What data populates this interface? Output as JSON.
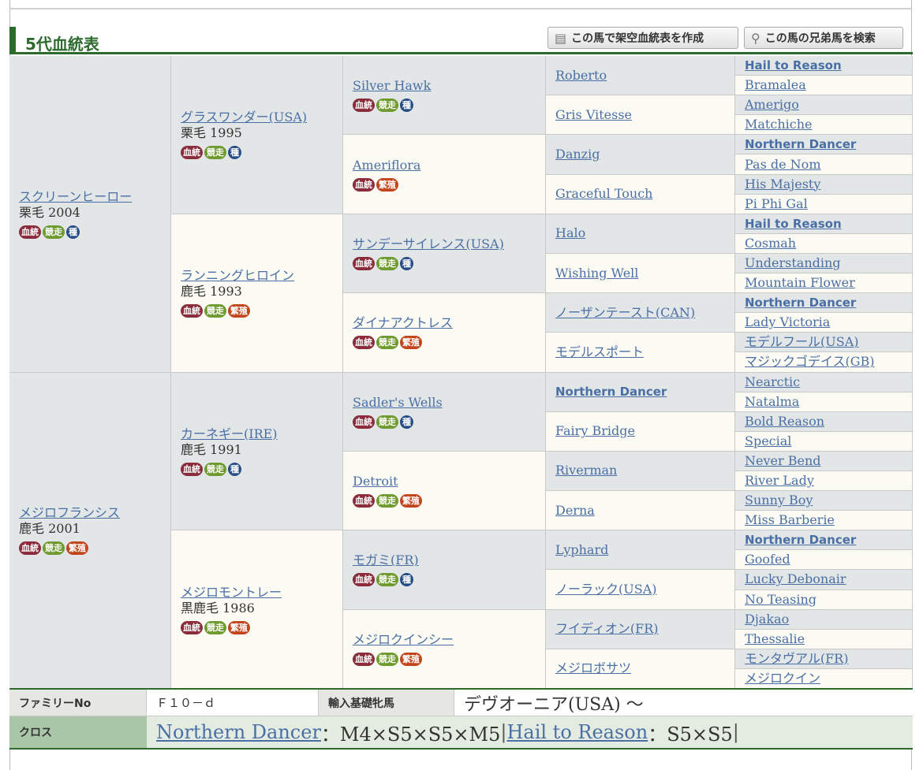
{
  "section": {
    "title": "5代血統表"
  },
  "buttons": {
    "create_fictional": "この馬で架空血統表を作成",
    "search_siblings": "この馬の兄弟馬を検索"
  },
  "badge_labels": {
    "blood": "血統",
    "race": "競走",
    "sire": "種",
    "breed": "繁殖"
  },
  "gen1": [
    {
      "name": "スクリーンヒーロー",
      "coat_year": "栗毛 2004",
      "badges": [
        "blood",
        "race",
        "sire"
      ]
    },
    {
      "name": "メジロフランシス",
      "coat_year": "鹿毛 2001",
      "badges": [
        "blood",
        "race",
        "breed"
      ]
    }
  ],
  "gen2": [
    {
      "name": "グラスワンダー(USA)",
      "coat_year": "栗毛 1995",
      "badges": [
        "blood",
        "race",
        "sire"
      ]
    },
    {
      "name": "ランニングヒロイン",
      "coat_year": "鹿毛 1993",
      "badges": [
        "blood",
        "race",
        "breed"
      ]
    },
    {
      "name": "カーネギー(IRE)",
      "coat_year": "鹿毛 1991",
      "badges": [
        "blood",
        "race",
        "sire"
      ]
    },
    {
      "name": "メジロモントレー",
      "coat_year": "黒鹿毛 1986",
      "badges": [
        "blood",
        "race",
        "breed"
      ]
    }
  ],
  "gen3": [
    {
      "name": "Silver Hawk",
      "badges": [
        "blood",
        "race",
        "sire"
      ]
    },
    {
      "name": "Ameriflora",
      "badges": [
        "blood",
        "breed"
      ]
    },
    {
      "name": "サンデーサイレンス(USA)",
      "badges": [
        "blood",
        "race",
        "sire"
      ]
    },
    {
      "name": "ダイナアクトレス",
      "badges": [
        "blood",
        "race",
        "breed"
      ]
    },
    {
      "name": "Sadler's Wells",
      "badges": [
        "blood",
        "race",
        "sire"
      ]
    },
    {
      "name": "Detroit",
      "badges": [
        "blood",
        "race",
        "breed"
      ]
    },
    {
      "name": "モガミ(FR)",
      "badges": [
        "blood",
        "race",
        "sire"
      ]
    },
    {
      "name": "メジロクインシー",
      "badges": [
        "blood",
        "race",
        "breed"
      ]
    }
  ],
  "gen4": [
    "Roberto",
    "Gris Vitesse",
    "Danzig",
    "Graceful Touch",
    "Halo",
    "Wishing Well",
    "ノーザンテースト(CAN)",
    "モデルスポート",
    "Northern Dancer",
    "Fairy Bridge",
    "Riverman",
    "Derna",
    "Lyphard",
    "ノーラック(USA)",
    "フイディオン(FR)",
    "メジロボサツ"
  ],
  "gen4_bold": [
    false,
    false,
    false,
    false,
    false,
    false,
    false,
    false,
    true,
    false,
    false,
    false,
    false,
    false,
    false,
    false
  ],
  "gen5": [
    "Hail to Reason",
    "Bramalea",
    "Amerigo",
    "Matchiche",
    "Northern Dancer",
    "Pas de Nom",
    "His Majesty",
    "Pi Phi Gal",
    "Hail to Reason",
    "Cosmah",
    "Understanding",
    "Mountain Flower",
    "Northern Dancer",
    "Lady Victoria",
    "モデルフール(USA)",
    "マジックゴデイス(GB)",
    "Nearctic",
    "Natalma",
    "Bold Reason",
    "Special",
    "Never Bend",
    "River Lady",
    "Sunny Boy",
    "Miss Barberie",
    "Northern Dancer",
    "Goofed",
    "Lucky Debonair",
    "No Teasing",
    "Djakao",
    "Thessalie",
    "モンタヴアル(FR)",
    "メジロクイン"
  ],
  "gen5_bold": [
    true,
    false,
    false,
    false,
    true,
    false,
    false,
    false,
    true,
    false,
    false,
    false,
    true,
    false,
    false,
    false,
    false,
    false,
    false,
    false,
    false,
    false,
    false,
    false,
    true,
    false,
    false,
    false,
    false,
    false,
    false,
    false
  ],
  "info": {
    "family_label": "ファミリーNo",
    "family_value": "Ｆ１０－ｄ",
    "import_label": "輸入基礎牝馬",
    "import_value": "デヴオーニア(USA) 〜",
    "cross_label": "クロス",
    "cross_items": [
      {
        "horse": "Northern Dancer",
        "detail": "：M4×S5×S5×M5"
      },
      {
        "horse": "Hail to Reason",
        "detail": "：S5×S5"
      }
    ],
    "cross_separator": "|"
  }
}
